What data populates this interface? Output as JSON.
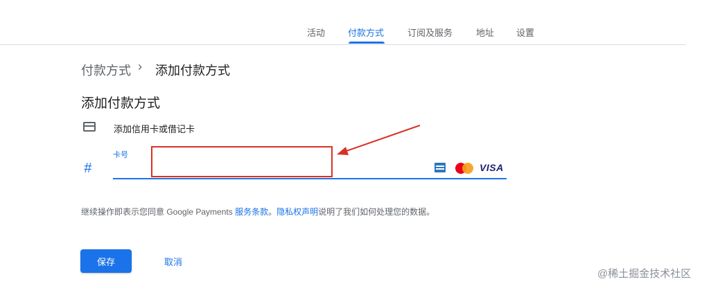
{
  "nav": {
    "tabs": [
      {
        "label": "活动",
        "active": false
      },
      {
        "label": "付款方式",
        "active": true
      },
      {
        "label": "订阅及服务",
        "active": false
      },
      {
        "label": "地址",
        "active": false
      },
      {
        "label": "设置",
        "active": false
      }
    ]
  },
  "breadcrumb": {
    "parent": "付款方式",
    "separator": "›",
    "current": "添加付款方式"
  },
  "page": {
    "title": "添加付款方式"
  },
  "card_section": {
    "label": "添加信用卡或借记卡",
    "icon": "credit-card-icon"
  },
  "card_number_field": {
    "prefix_symbol": "#",
    "label": "卡号",
    "value": "",
    "placeholder": ""
  },
  "brands": {
    "amex": "amex-logo",
    "mastercard": "mastercard-logo",
    "visa": "VISA"
  },
  "legal": {
    "prefix": "继续操作即表示您同意 Google Payments ",
    "terms_link": "服务条款",
    "middle": "。",
    "privacy_link": "隐私权声明",
    "suffix": "说明了我们如何处理您的数据。"
  },
  "actions": {
    "save": "保存",
    "cancel": "取消"
  },
  "watermark": "@稀土掘金技术社区",
  "colors": {
    "accent": "#1a73e8",
    "highlight_box": "#d93025",
    "arrow": "#d93025"
  }
}
